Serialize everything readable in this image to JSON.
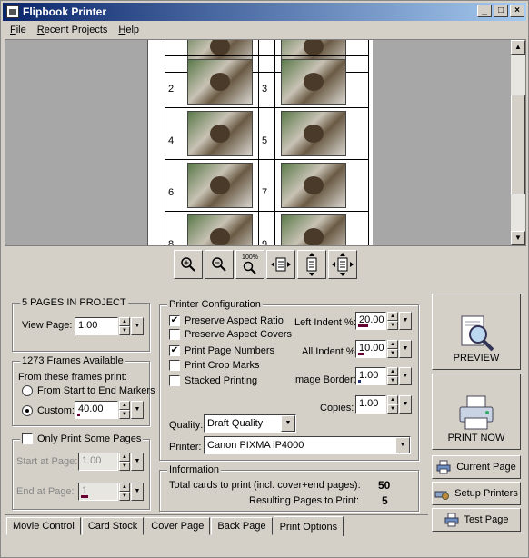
{
  "window": {
    "title": "Flipbook Printer"
  },
  "titlebar_buttons": {
    "minimize": "_",
    "maximize": "□",
    "close": "×"
  },
  "menu": [
    {
      "label": "File"
    },
    {
      "label": "Recent Projects"
    },
    {
      "label": "Help"
    }
  ],
  "preview": {
    "cells": [
      {
        "num": "2"
      },
      {
        "num": "3"
      },
      {
        "num": "4"
      },
      {
        "num": "5"
      },
      {
        "num": "6"
      },
      {
        "num": "7"
      },
      {
        "num": "8"
      },
      {
        "num": "9"
      }
    ]
  },
  "zoom_toolbar": [
    {
      "icon": "zoom-in-icon"
    },
    {
      "icon": "zoom-out-icon"
    },
    {
      "icon": "zoom-100-icon",
      "text": "100%"
    },
    {
      "icon": "fit-width-icon"
    },
    {
      "icon": "fit-height-icon"
    },
    {
      "icon": "fit-page-icon"
    }
  ],
  "project": {
    "group_label": "5 PAGES IN PROJECT",
    "view_page_label": "View Page:",
    "view_page_value": "1.00"
  },
  "frames": {
    "group_label": "1273 Frames Available",
    "from_label": "From these frames print:",
    "radio_markers": "From Start to End Markers",
    "radio_custom": "Custom:",
    "custom_value": "40.00",
    "custom_level": 0.03
  },
  "only_pages": {
    "checkbox_label": "Only Print Some Pages",
    "start_label": "Start at Page:",
    "start_value": "1.00",
    "end_label": "End at Page:",
    "end_value": "1",
    "end_level": 0.2
  },
  "printer_config": {
    "group_label": "Printer Configuration",
    "preserve_aspect_ratio": "Preserve Aspect Ratio",
    "preserve_aspect_covers": "Preserve Aspect Covers",
    "print_page_numbers": "Print Page Numbers",
    "print_crop_marks": "Print Crop Marks",
    "stacked_printing": "Stacked Printing",
    "left_indent_label": "Left Indent %:",
    "left_indent_value": "20.00",
    "left_indent_level": 0.4,
    "all_indent_label": "All Indent %:",
    "all_indent_value": "10.00",
    "all_indent_level": 0.2,
    "image_border_label": "Image Border:",
    "image_border_value": "1.00",
    "image_border_level": 0.1,
    "copies_label": "Copies:",
    "copies_value": "1.00",
    "quality_label": "Quality:",
    "quality_value": "Draft Quality",
    "printer_label": "Printer:",
    "printer_value": "Canon PIXMA iP4000"
  },
  "information": {
    "group_label": "Information",
    "total_cards_label": "Total cards to print (incl. cover+end pages):",
    "total_cards_value": "50",
    "resulting_pages_label": "Resulting Pages to Print:",
    "resulting_pages_value": "5"
  },
  "buttons": {
    "preview": "PREVIEW",
    "print_now": "PRINT NOW",
    "current_page": "Current Page",
    "setup_printers": "Setup Printers",
    "test_page": "Test Page"
  },
  "tabs": [
    {
      "label": "Movie Control"
    },
    {
      "label": "Card Stock"
    },
    {
      "label": "Cover Page"
    },
    {
      "label": "Back Page"
    },
    {
      "label": "Print Options"
    }
  ],
  "colors": {
    "title_start": "#0a246a",
    "title_end": "#a6caf0",
    "face": "#d4d0c8",
    "progress": "#660033"
  }
}
